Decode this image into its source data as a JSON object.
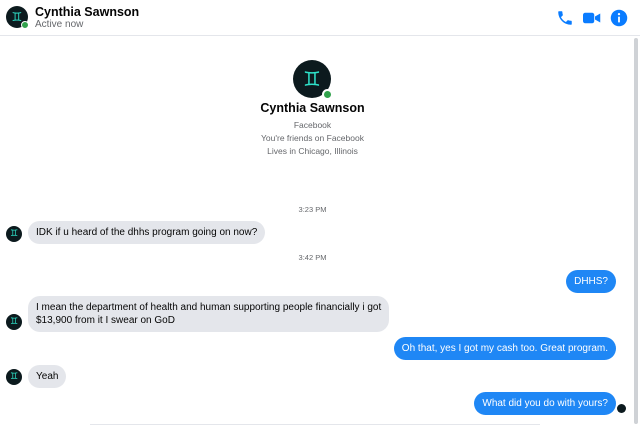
{
  "header": {
    "name": "Cynthia Sawnson",
    "status": "Active now",
    "icons": [
      "phone-icon",
      "video-camera-icon",
      "info-icon"
    ],
    "accent_color": "#0a7cff"
  },
  "profile": {
    "name": "Cynthia Sawnson",
    "source": "Facebook",
    "friendship": "You're friends on Facebook",
    "location": "Lives in Chicago, Illinois"
  },
  "thread": {
    "timestamps": [
      "3:23 PM",
      "3:42 PM"
    ],
    "messages": [
      {
        "from": "them",
        "text": "IDK if u heard of the dhhs program going on now?"
      },
      {
        "from": "me",
        "text": "DHHS?"
      },
      {
        "from": "them",
        "line1": "I mean the department of health and human supporting people financially i got",
        "line2": "$13,900 from it I swear on GoD"
      },
      {
        "from": "me",
        "text": "Oh that, yes I got my cash too. Great program."
      },
      {
        "from": "them",
        "text": "Yeah"
      },
      {
        "from": "me",
        "text": "What did you do with yours?"
      }
    ]
  },
  "colors": {
    "outgoing_bubble": "#1f87f5",
    "incoming_bubble": "#e4e6eb",
    "online_dot": "#31a24c"
  }
}
